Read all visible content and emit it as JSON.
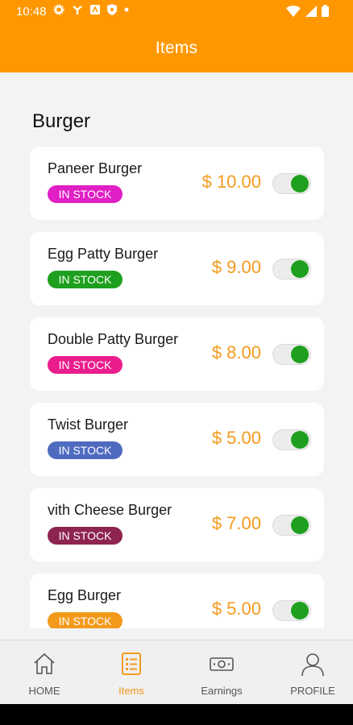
{
  "status_bar": {
    "time": "10:48"
  },
  "app_bar": {
    "title": "Items"
  },
  "section": {
    "title": "Burger"
  },
  "items": [
    {
      "name": "Paneer Burger",
      "stock": "IN STOCK",
      "price": "$ 10.00",
      "badge_color": "#e01fc4"
    },
    {
      "name": "Egg Patty Burger",
      "stock": "IN STOCK",
      "price": "$ 9.00",
      "badge_color": "#1ea01e"
    },
    {
      "name": "Double Patty Burger",
      "stock": "IN STOCK",
      "price": "$ 8.00",
      "badge_color": "#e91e8c"
    },
    {
      "name": "Twist Burger",
      "stock": "IN STOCK",
      "price": "$ 5.00",
      "badge_color": "#4f6bc0"
    },
    {
      "name": "vith Cheese Burger",
      "stock": "IN STOCK",
      "price": "$ 7.00",
      "badge_color": "#8e2452"
    },
    {
      "name": "Egg Burger",
      "stock": "IN STOCK",
      "price": "$ 5.00",
      "badge_color": "#f39a1c"
    }
  ],
  "nav": {
    "home": "HOME",
    "items": "Items",
    "earnings": "Earnings",
    "profile": "PROFILE"
  },
  "colors": {
    "accent": "#ff9800",
    "price": "#f39a1c",
    "toggle_on": "#1ea01e"
  }
}
